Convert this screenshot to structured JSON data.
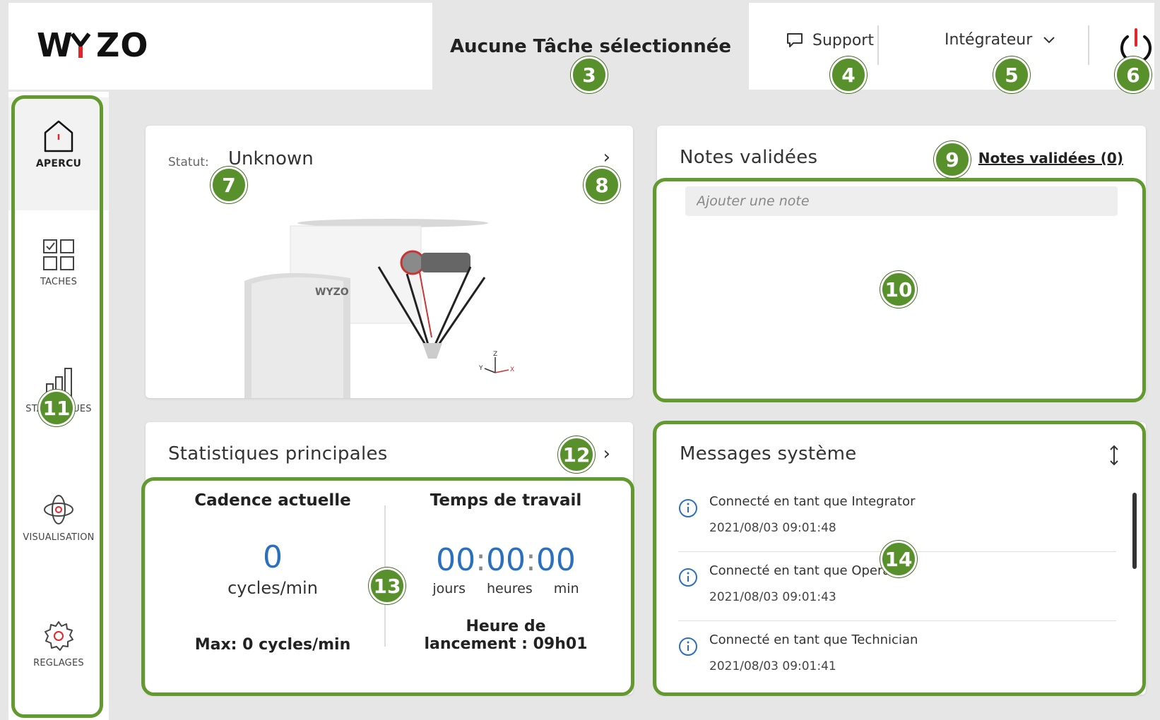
{
  "header": {
    "logo_text": "WYZO",
    "task_title": "Aucune Tâche sélectionnée",
    "support_label": "Support",
    "role_label": "Intégrateur",
    "accent_color": "#e3262b",
    "icons": [
      "chat-icon",
      "chevron-down-icon",
      "power-icon"
    ]
  },
  "sidebar": {
    "items": [
      {
        "label": "APERCU",
        "icon": "home-icon",
        "active": true
      },
      {
        "label": "TACHES",
        "icon": "tasks-grid-icon",
        "active": false
      },
      {
        "label": "STATISTIQUES",
        "icon": "bar-chart-icon",
        "active": false
      },
      {
        "label": "VISUALISATION",
        "icon": "visualisation-icon",
        "active": false
      },
      {
        "label": "REGLAGES",
        "icon": "gear-icon",
        "active": false
      }
    ]
  },
  "status_card": {
    "label": "Statut:",
    "value": "Unknown",
    "robot_brand": "WYZO",
    "axis_labels": [
      "Z",
      "Y",
      "X"
    ]
  },
  "notes_card": {
    "title": "Notes validées",
    "link": "Notes validées (0)",
    "placeholder": "Ajouter une note"
  },
  "stats_card": {
    "title": "Statistiques principales",
    "cadence_title": "Cadence actuelle",
    "cadence_value": "0",
    "cadence_unit": "cycles/min",
    "cadence_max": "Max: 0 cycles/min",
    "work_title": "Temps de travail",
    "work_days": "00",
    "work_hours": "00",
    "work_min": "00",
    "sep": ":",
    "label_days": "jours",
    "label_hours": "heures",
    "label_min": "min",
    "launch_line1": "Heure de",
    "launch_line2": "lancement : 09h01"
  },
  "messages_card": {
    "title": "Messages système",
    "items": [
      {
        "text": "Connecté en tant que Integrator",
        "time": "2021/08/03  09:01:48"
      },
      {
        "text": "Connecté en tant que Operator",
        "time": "2021/08/03  09:01:43"
      },
      {
        "text": "Connecté en tant que Technician",
        "time": "2021/08/03  09:01:41"
      }
    ]
  },
  "annotations": {
    "color": "#58902c",
    "badges": [
      "3",
      "4",
      "5",
      "6",
      "7",
      "8",
      "9",
      "10",
      "11",
      "12",
      "13",
      "14"
    ]
  }
}
